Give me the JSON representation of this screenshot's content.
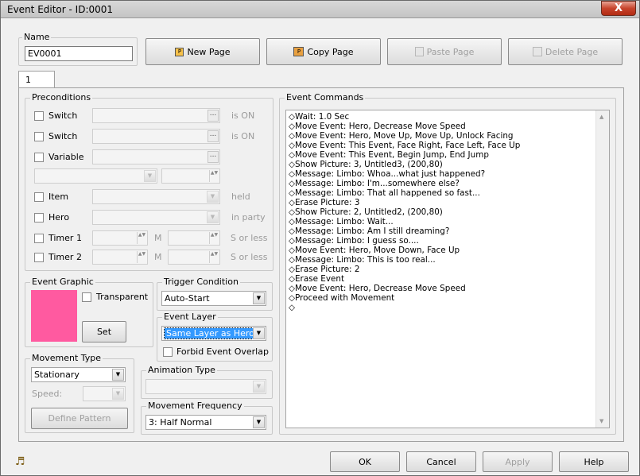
{
  "window": {
    "title": "Event Editor - ID:0001",
    "close": "X"
  },
  "name_group": {
    "legend": "Name",
    "value": "EV0001"
  },
  "page_buttons": {
    "new_page": "New Page",
    "copy_page": "Copy Page",
    "paste_page": "Paste Page",
    "delete_page": "Delete Page"
  },
  "tabs": [
    "1"
  ],
  "preconditions": {
    "legend": "Preconditions",
    "switch1": {
      "label": "Switch",
      "suffix": "is ON"
    },
    "switch2": {
      "label": "Switch",
      "suffix": "is ON"
    },
    "variable": {
      "label": "Variable"
    },
    "item": {
      "label": "Item",
      "suffix": "held"
    },
    "hero": {
      "label": "Hero",
      "suffix": "in party"
    },
    "timer1": {
      "label": "Timer 1",
      "m": "M",
      "s": "S or less"
    },
    "timer2": {
      "label": "Timer 2",
      "m": "M",
      "s": "S or less"
    },
    "dots": "...",
    "spin": "▲▼"
  },
  "event_graphic": {
    "legend": "Event Graphic",
    "transparent": "Transparent",
    "set": "Set",
    "color": "#ff5aa0"
  },
  "trigger": {
    "legend": "Trigger Condition",
    "value": "Auto-Start"
  },
  "layer": {
    "legend": "Event Layer",
    "value": "Same Layer as Hero",
    "forbid": "Forbid Event Overlap"
  },
  "movement_type": {
    "legend": "Movement Type",
    "value": "Stationary",
    "speed_label": "Speed:",
    "define": "Define Pattern"
  },
  "animation": {
    "legend": "Animation Type"
  },
  "frequency": {
    "legend": "Movement Frequency",
    "value": "3: Half Normal"
  },
  "commands": {
    "legend": "Event Commands",
    "lines": [
      "◇Wait: 1.0 Sec",
      "◇Move Event: Hero, Decrease Move Speed",
      "◇Move Event: Hero, Move Up, Move Up, Unlock Facing",
      "◇Move Event: This Event, Face Right, Face Left, Face Up",
      "◇Move Event: This Event, Begin Jump, End Jump",
      "◇Show Picture: 3, Untitled3, (200,80)",
      "◇Message: Limbo: Whoa...what just happened?",
      "◇Message: Limbo: I'm...somewhere else?",
      "◇Message: Limbo: That all happened so fast...",
      "◇Erase Picture: 3",
      "◇Show Picture: 2, Untitled2, (200,80)",
      "◇Message: Limbo: Wait...",
      "◇Message: Limbo: Am I still dreaming?",
      "◇Message: Limbo: I guess so....",
      "◇Move Event: Hero, Move Down, Face Up",
      "◇Message: Limbo: This is too real...",
      "◇Erase Picture: 2",
      "◇Erase Event",
      "◇Move Event: Hero, Decrease Move Speed",
      "◇Proceed with Movement",
      "◇"
    ],
    "scroll_up": "▲",
    "scroll_down": "▼"
  },
  "footer": {
    "ok": "OK",
    "cancel": "Cancel",
    "apply": "Apply",
    "help": "Help",
    "music_icon": "♬"
  }
}
